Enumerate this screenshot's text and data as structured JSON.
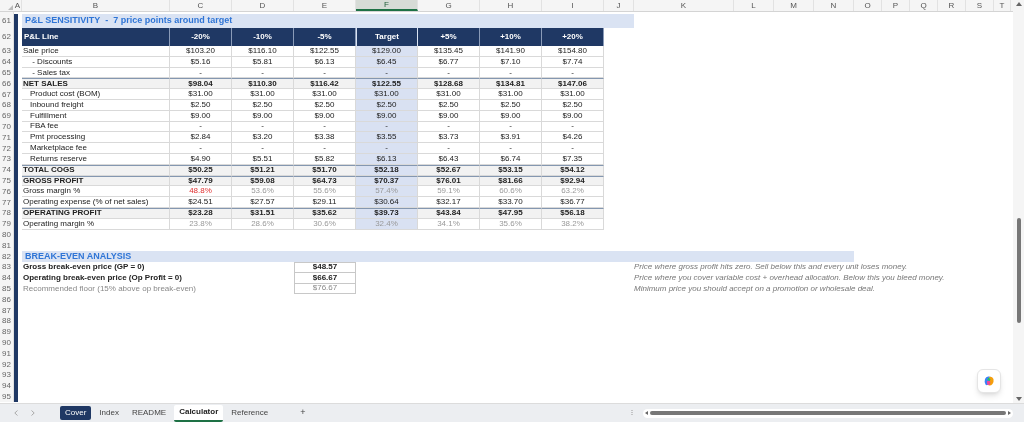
{
  "column_headers": [
    {
      "label": "A",
      "selected": false
    },
    {
      "label": "B",
      "selected": false
    },
    {
      "label": "C",
      "selected": false
    },
    {
      "label": "D",
      "selected": false
    },
    {
      "label": "E",
      "selected": false
    },
    {
      "label": "F",
      "selected": true
    },
    {
      "label": "G",
      "selected": false
    },
    {
      "label": "H",
      "selected": false
    },
    {
      "label": "I",
      "selected": false
    },
    {
      "label": "J",
      "selected": false
    },
    {
      "label": "K",
      "selected": false
    },
    {
      "label": "L",
      "selected": false
    },
    {
      "label": "M",
      "selected": false
    },
    {
      "label": "N",
      "selected": false
    },
    {
      "label": "O",
      "selected": false
    },
    {
      "label": "P",
      "selected": false
    },
    {
      "label": "Q",
      "selected": false
    },
    {
      "label": "R",
      "selected": false
    },
    {
      "label": "S",
      "selected": false
    },
    {
      "label": "T",
      "selected": false
    }
  ],
  "sensitivity": {
    "title_row": "61",
    "title": "P&L SENSITIVITY  -  7 price points around target",
    "header": {
      "row": "62",
      "label": "P&L Line",
      "columns": [
        {
          "label": "-20%",
          "highlighted": false
        },
        {
          "label": "-10%",
          "highlighted": false
        },
        {
          "label": "-5%",
          "highlighted": false
        },
        {
          "label": "Target",
          "highlighted": true
        },
        {
          "label": "+5%",
          "highlighted": false
        },
        {
          "label": "+10%",
          "highlighted": false
        },
        {
          "label": "+20%",
          "highlighted": false
        }
      ]
    },
    "rows": [
      {
        "row": "63",
        "label": "Sale price",
        "kind": "plain",
        "values": [
          "$103.20",
          "$116.10",
          "$122.55",
          "$129.00",
          "$135.45",
          "$141.90",
          "$154.80"
        ]
      },
      {
        "row": "64",
        "label": " - Discounts",
        "kind": "sub",
        "values": [
          "$5.16",
          "$5.81",
          "$6.13",
          "$6.45",
          "$6.77",
          "$7.10",
          "$7.74"
        ]
      },
      {
        "row": "65",
        "label": " - Sales tax",
        "kind": "sub",
        "values": [
          "-",
          "-",
          "-",
          "-",
          "-",
          "-",
          "-"
        ]
      },
      {
        "row": "66",
        "label": "NET SALES",
        "kind": "total",
        "values": [
          "$98.04",
          "$110.30",
          "$116.42",
          "$122.55",
          "$128.68",
          "$134.81",
          "$147.06"
        ]
      },
      {
        "row": "67",
        "label": "Product cost (BOM)",
        "kind": "sub",
        "values": [
          "$31.00",
          "$31.00",
          "$31.00",
          "$31.00",
          "$31.00",
          "$31.00",
          "$31.00"
        ]
      },
      {
        "row": "68",
        "label": "Inbound freight",
        "kind": "sub",
        "values": [
          "$2.50",
          "$2.50",
          "$2.50",
          "$2.50",
          "$2.50",
          "$2.50",
          "$2.50"
        ]
      },
      {
        "row": "69",
        "label": "Fulfillment",
        "kind": "sub",
        "values": [
          "$9.00",
          "$9.00",
          "$9.00",
          "$9.00",
          "$9.00",
          "$9.00",
          "$9.00"
        ]
      },
      {
        "row": "70",
        "label": "FBA fee",
        "kind": "sub",
        "values": [
          "-",
          "-",
          "-",
          "-",
          "-",
          "-",
          "-"
        ]
      },
      {
        "row": "71",
        "label": "Pmt processing",
        "kind": "sub",
        "values": [
          "$2.84",
          "$3.20",
          "$3.38",
          "$3.55",
          "$3.73",
          "$3.91",
          "$4.26"
        ]
      },
      {
        "row": "72",
        "label": "Marketplace fee",
        "kind": "sub",
        "values": [
          "-",
          "-",
          "-",
          "-",
          "-",
          "-",
          "-"
        ]
      },
      {
        "row": "73",
        "label": "Returns reserve",
        "kind": "sub",
        "values": [
          "$4.90",
          "$5.51",
          "$5.82",
          "$6.13",
          "$6.43",
          "$6.74",
          "$7.35"
        ]
      },
      {
        "row": "74",
        "label": "TOTAL COGS",
        "kind": "total",
        "values": [
          "$50.25",
          "$51.21",
          "$51.70",
          "$52.18",
          "$52.67",
          "$53.15",
          "$54.12"
        ]
      },
      {
        "row": "75",
        "label": "GROSS PROFIT",
        "kind": "total",
        "values": [
          "$47.79",
          "$59.08",
          "$64.73",
          "$70.37",
          "$76.01",
          "$81.66",
          "$92.94"
        ]
      },
      {
        "row": "76",
        "label": "Gross margin %",
        "kind": "percent",
        "values": [
          "48.8%",
          "53.6%",
          "55.6%",
          "57.4%",
          "59.1%",
          "60.6%",
          "63.2%"
        ],
        "alerts": [
          true,
          false,
          false,
          false,
          false,
          false,
          false
        ]
      },
      {
        "row": "77",
        "label": "Operating expense (% of net sales)",
        "kind": "plain",
        "values": [
          "$24.51",
          "$27.57",
          "$29.11",
          "$30.64",
          "$32.17",
          "$33.70",
          "$36.77"
        ]
      },
      {
        "row": "78",
        "label": "OPERATING PROFIT",
        "kind": "total",
        "values": [
          "$23.28",
          "$31.51",
          "$35.62",
          "$39.73",
          "$43.84",
          "$47.95",
          "$56.18"
        ]
      },
      {
        "row": "79",
        "label": "Operating margin %",
        "kind": "percent",
        "values": [
          "23.8%",
          "28.6%",
          "30.6%",
          "32.4%",
          "34.1%",
          "35.6%",
          "38.2%"
        ],
        "alerts": [
          false,
          false,
          false,
          false,
          false,
          false,
          false
        ]
      }
    ]
  },
  "blank_rows_between": [
    "80",
    "81"
  ],
  "break_even": {
    "title_row": "82",
    "title": "BREAK-EVEN ANALYSIS",
    "rows": [
      {
        "row": "83",
        "label": "Gross break-even price (GP = 0)",
        "kind": "bold",
        "value": "$48.57",
        "note": "Price where gross profit hits zero. Sell below this and every unit loses money."
      },
      {
        "row": "84",
        "label": "Operating break-even price (Op Profit = 0)",
        "kind": "bold",
        "value": "$66.67",
        "note": "Price where you cover variable cost + overhead allocation. Below this you bleed money."
      },
      {
        "row": "85",
        "label": "Recommended floor (15% above op break-even)",
        "kind": "muted",
        "value": "$76.67",
        "note": "Minimum price you should accept on a promotion or wholesale deal."
      }
    ]
  },
  "blank_rows_after": [
    "86",
    "87",
    "88",
    "89",
    "90",
    "91",
    "92",
    "93",
    "94",
    "95"
  ],
  "sheet_tabs": [
    {
      "label": "Cover",
      "selected": false,
      "color": "#1f3864"
    },
    {
      "label": "Index",
      "selected": false
    },
    {
      "label": "README",
      "selected": false
    },
    {
      "label": "Calculator",
      "selected": true
    },
    {
      "label": "Reference",
      "selected": false
    }
  ],
  "add_sheet": "+"
}
